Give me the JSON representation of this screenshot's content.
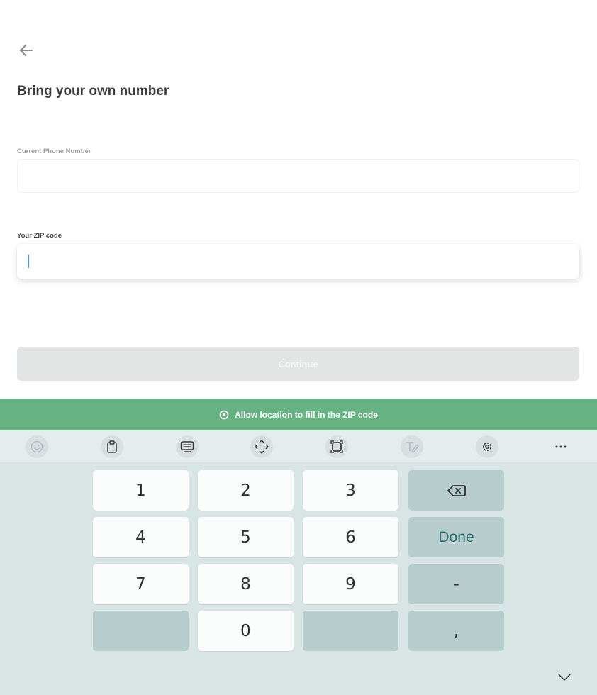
{
  "header": {
    "back_icon": "arrow-left-icon",
    "title": "Bring your own number"
  },
  "form": {
    "phone_label": "Current Phone Number",
    "phone_value": "",
    "zip_label": "Your ZIP code",
    "zip_value": "",
    "continue_label": "Continue"
  },
  "location_banner": {
    "icon": "location-target-icon",
    "text": "Allow location to fill in the ZIP code"
  },
  "keyboard_toolbar": {
    "items": [
      "emoji-icon",
      "clipboard-icon",
      "keyboard-layout-icon",
      "cursor-move-icon",
      "one-handed-mode-icon",
      "handwriting-icon",
      "settings-gear-icon",
      "more-options-icon"
    ]
  },
  "keypad": {
    "digits": [
      "1",
      "2",
      "3",
      "4",
      "5",
      "6",
      "7",
      "8",
      "9",
      "0"
    ],
    "done_label": "Done",
    "dash": "-",
    "comma": ",",
    "backspace_icon": "backspace-icon",
    "hide_icon": "chevron-down-icon"
  },
  "colors": {
    "banner": "#67b283",
    "keyboard_bg": "#d9e4e5",
    "key_light": "#fbfcfc",
    "key_dark": "#b6cccd",
    "done_text": "#2c6f6c"
  }
}
